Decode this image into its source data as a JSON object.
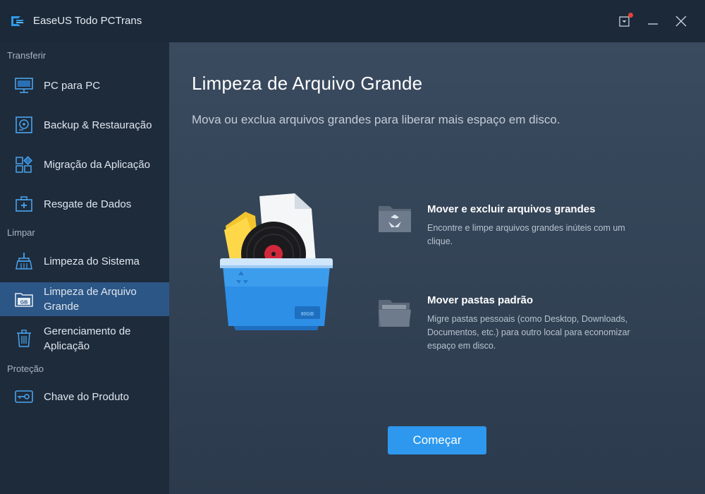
{
  "app": {
    "title": "EaseUS Todo PCTrans",
    "logo_icon": "easeus-logo-icon",
    "notification_icon": "notification-icon",
    "minimize_icon": "minimize-icon",
    "close_icon": "close-icon"
  },
  "sidebar": {
    "sections": [
      {
        "label": "Transferir"
      },
      {
        "label": "Limpar"
      },
      {
        "label": "Proteção"
      }
    ],
    "items": [
      {
        "label": "PC para PC",
        "icon": "monitor-icon"
      },
      {
        "label": "Backup & Restauração",
        "icon": "backup-disk-icon"
      },
      {
        "label": "Migração da Aplicação",
        "icon": "app-grid-icon"
      },
      {
        "label": "Resgate de Dados",
        "icon": "medkit-icon"
      },
      {
        "label": "Limpeza do Sistema",
        "icon": "broom-icon"
      },
      {
        "label": "Limpeza de Arquivo Grande",
        "icon": "gb-folder-icon",
        "active": true,
        "badge": "GB"
      },
      {
        "label": "Gerenciamento de Aplicação",
        "icon": "trash-icon"
      },
      {
        "label": "Chave do Produto",
        "icon": "key-icon"
      }
    ]
  },
  "main": {
    "title": "Limpeza de Arquivo Grande",
    "subtitle": "Mova ou exclua arquivos grandes para liberar mais espaço em disco.",
    "illustration_badge": "80GB",
    "features": [
      {
        "title": "Mover e excluir arquivos grandes",
        "description": "Encontre e limpe arquivos grandes inúteis com um clique.",
        "icon": "recycle-folder-icon"
      },
      {
        "title": "Mover pastas padrão",
        "description": "Migre pastas pessoais (como Desktop, Downloads, Documentos, etc.) para outro local para economizar espaço em disco.",
        "icon": "open-folder-icon"
      }
    ],
    "start_button": "Começar"
  },
  "colors": {
    "accent": "#2d98ee",
    "sidebar_active": "#2c5686",
    "notification_dot": "#e8413a"
  }
}
